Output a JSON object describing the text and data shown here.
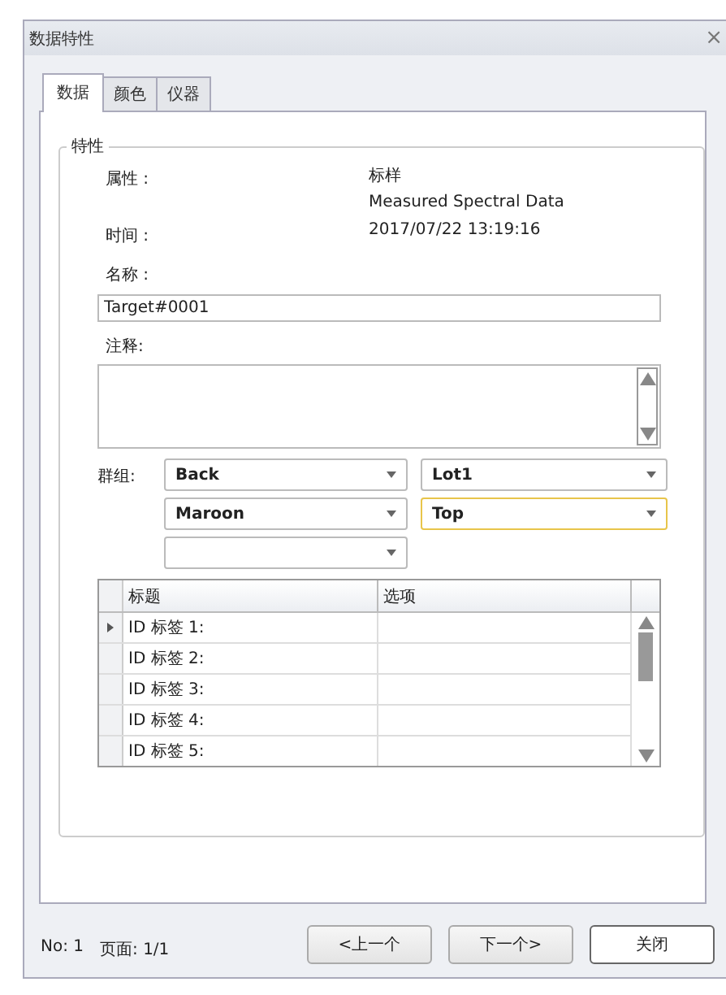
{
  "window": {
    "title": "数据特性",
    "close": "×"
  },
  "tabs": [
    {
      "label": "数据",
      "selected": true
    },
    {
      "label": "颜色",
      "selected": false
    },
    {
      "label": "仪器",
      "selected": false
    }
  ],
  "group": {
    "title": "特性",
    "attribute": {
      "label": "属性 :",
      "values": [
        "标样",
        "Measured Spectral Data"
      ]
    },
    "time": {
      "label": "时间 :",
      "value": "2017/07/22 13:19:16"
    },
    "name": {
      "label": "名称 :",
      "value": "Target#0001"
    },
    "note": {
      "label": "注释:"
    },
    "groups": {
      "label": "群组:",
      "dropdowns": [
        {
          "value": "Back",
          "focused": false
        },
        {
          "value": "Lot1",
          "focused": false
        },
        {
          "value": "Maroon",
          "focused": false
        },
        {
          "value": "Top",
          "focused": true
        },
        {
          "focused": false
        }
      ]
    },
    "table": {
      "columns": [
        "标题",
        "选项"
      ],
      "rows": [
        {
          "title": "ID 标签 1:",
          "selected": true
        },
        {
          "title": "ID 标签 2:",
          "selected": false
        },
        {
          "title": "ID 标签 3:",
          "selected": false
        },
        {
          "title": "ID 标签 4:",
          "selected": false
        },
        {
          "title": "ID 标签 5:",
          "selected": false
        }
      ]
    }
  },
  "status": {
    "number": "No:  1",
    "page": "页面: 1/1"
  },
  "buttons": [
    "<上一个",
    "下一个>",
    "关闭"
  ]
}
